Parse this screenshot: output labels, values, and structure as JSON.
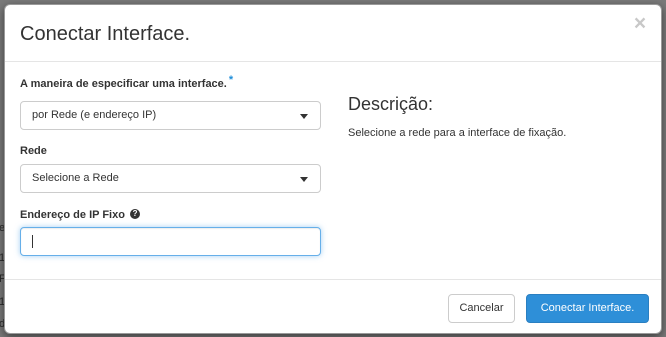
{
  "modal": {
    "title": "Conectar Interface.",
    "close_symbol": "×"
  },
  "form": {
    "method_label": "A maneira de especificar uma interface.",
    "required_marker": "*",
    "method_value": "por Rede (e endereço IP)",
    "network_label": "Rede",
    "network_value": "Selecione a Rede",
    "fixed_ip_label": "Endereço de IP Fixo",
    "help_symbol": "?",
    "fixed_ip_value": ""
  },
  "description": {
    "title": "Descrição:",
    "text": "Selecione a rede para a interface de fixação."
  },
  "footer": {
    "cancel_label": "Cancelar",
    "submit_label": "Conectar Interface."
  },
  "background_glyphs": [
    "e",
    "1",
    "Fi",
    "1",
    "d"
  ],
  "colors": {
    "primary": "#2e8fd8",
    "required": "#1f8ed9",
    "focus_border": "#66afe9",
    "backdrop": "#7a7a7a"
  },
  "icons": {
    "close": "close-icon",
    "dropdown": "chevron-down-icon",
    "help": "question-circle-icon"
  }
}
